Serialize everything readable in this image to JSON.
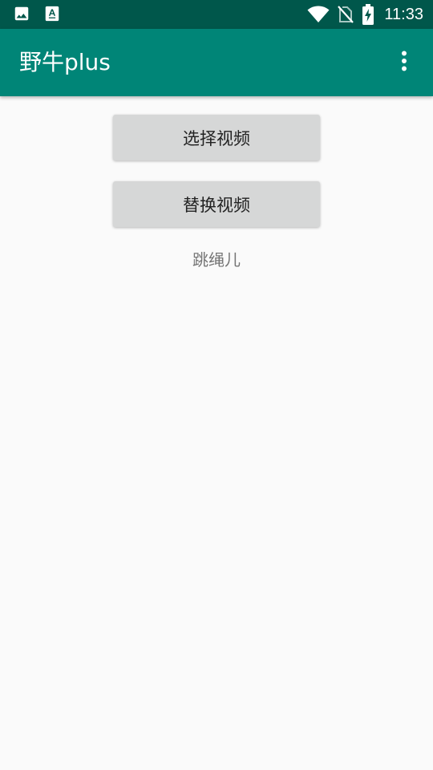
{
  "status_bar": {
    "time": "11:33",
    "left_icons": [
      "image-icon",
      "font-download-icon"
    ],
    "right_icons": [
      "wifi-icon",
      "no-sim-icon",
      "battery-charging-icon"
    ]
  },
  "app_bar": {
    "title": "野牛plus",
    "overflow_icon": "more-vert-icon"
  },
  "main": {
    "select_video_label": "选择视频",
    "replace_video_label": "替换视频",
    "caption": "跳绳儿"
  },
  "colors": {
    "status_bar": "#00574b",
    "app_bar": "#008577",
    "background": "#fafafa",
    "button": "#d6d7d7",
    "caption_text": "#757575"
  }
}
